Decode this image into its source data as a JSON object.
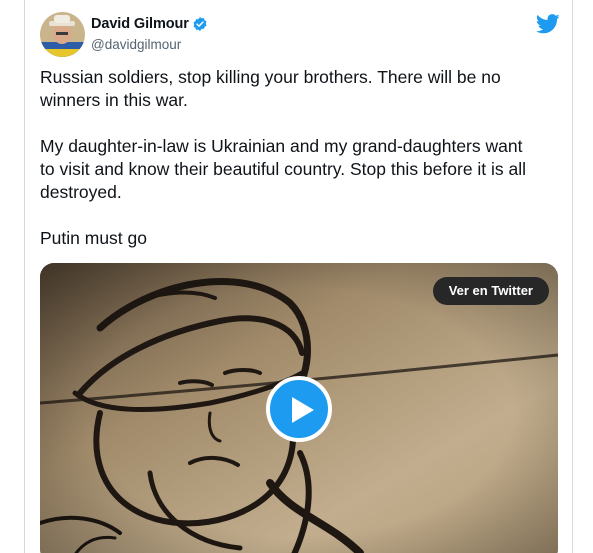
{
  "tweet": {
    "author_name": "David Gilmour",
    "author_handle": "@davidgilmour",
    "verified": true,
    "paragraphs": [
      "Russian soldiers, stop killing your brothers. There will be no winners in this war.",
      "My daughter-in-law is Ukrainian and my grand-daughters want to visit and know their beautiful country. Stop this before it is all destroyed.",
      "Putin must go"
    ],
    "media": {
      "watch_label": "Ver en Twitter"
    }
  },
  "colors": {
    "twitter_blue": "#1d9bf0",
    "text": "#0f1419",
    "secondary_text": "#536471",
    "video_bg": "#b9a586"
  },
  "icons": [
    "verified-badge-icon",
    "twitter-bird-icon",
    "play-icon"
  ]
}
